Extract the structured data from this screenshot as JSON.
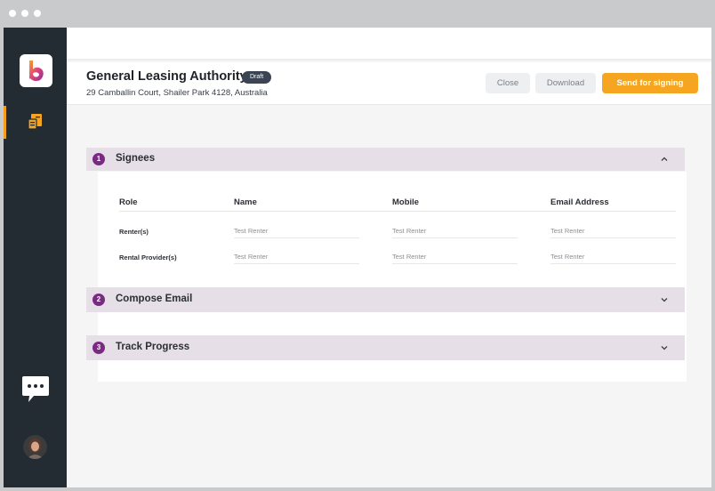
{
  "colors": {
    "sidebar": "#232b33",
    "accent": "#f6a521",
    "section_bg": "#e6dfe8",
    "step_badge": "#7b2a84",
    "draft_badge": "#3a4452"
  },
  "sidebar": {
    "logo_icon": "brand-logo",
    "nav_icon": "document-icon",
    "chat_icon": "chat-bubble-icon",
    "avatar_icon": "user-avatar"
  },
  "document": {
    "title": "General Leasing Authority",
    "status_badge": "Draft",
    "address": "29 Camballin Court, Shailer Park 4128, Australia"
  },
  "actions": {
    "close_label": "Close",
    "download_label": "Download",
    "send_label": "Send for signing"
  },
  "sections": [
    {
      "number": "1",
      "title": "Signees",
      "expanded": true
    },
    {
      "number": "2",
      "title": "Compose Email",
      "expanded": false
    },
    {
      "number": "3",
      "title": "Track Progress",
      "expanded": false
    }
  ],
  "signees": {
    "columns": [
      "Role",
      "Name",
      "Mobile",
      "Email Address"
    ],
    "rows": [
      {
        "role": "Renter(s)",
        "name": "Test Renter",
        "mobile": "Test Renter",
        "email": "Test Renter"
      },
      {
        "role": "Rental Provider(s)",
        "name": "Test Renter",
        "mobile": "Test Renter",
        "email": "Test Renter"
      }
    ]
  }
}
